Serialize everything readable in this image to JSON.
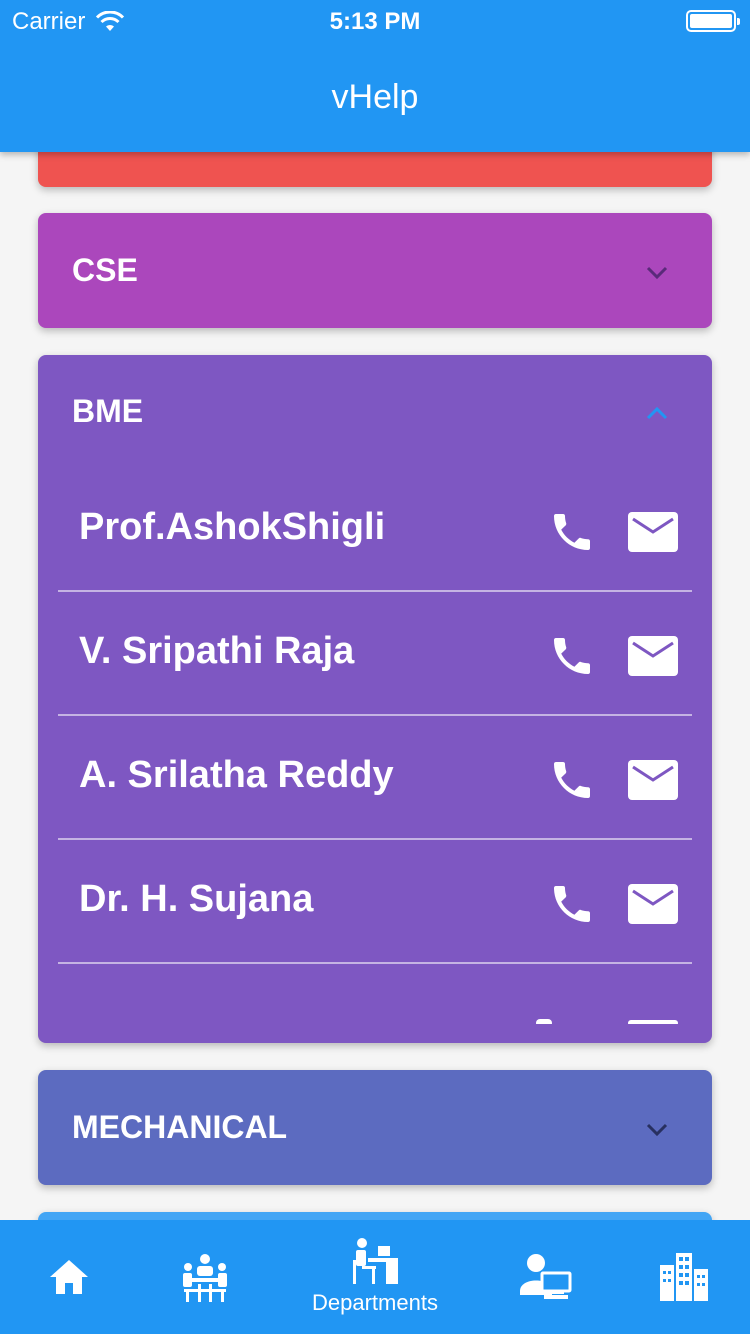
{
  "status_bar": {
    "carrier": "Carrier",
    "time": "5:13 PM"
  },
  "app_bar": {
    "title": "vHelp"
  },
  "departments": [
    {
      "name": "CSE",
      "expanded": false,
      "color": "#ab47bc"
    },
    {
      "name": "BME",
      "expanded": true,
      "color": "#7e57c2"
    },
    {
      "name": "MECHANICAL",
      "expanded": false,
      "color": "#5c6bc0"
    }
  ],
  "bme_staff": [
    {
      "name": "Prof.AshokShigli"
    },
    {
      "name": "V. Sripathi Raja"
    },
    {
      "name": "A. Srilatha Reddy"
    },
    {
      "name": "Dr. H. Sujana"
    }
  ],
  "bottom_nav": {
    "items": [
      {
        "icon": "home-icon"
      },
      {
        "icon": "meeting-icon"
      },
      {
        "icon": "departments-icon",
        "label": "Departments",
        "active": true
      },
      {
        "icon": "staff-icon"
      },
      {
        "icon": "building-icon"
      }
    ]
  },
  "colors": {
    "primary": "#2196f3",
    "red_card": "#ef5350",
    "blue_card": "#42a5f5"
  }
}
